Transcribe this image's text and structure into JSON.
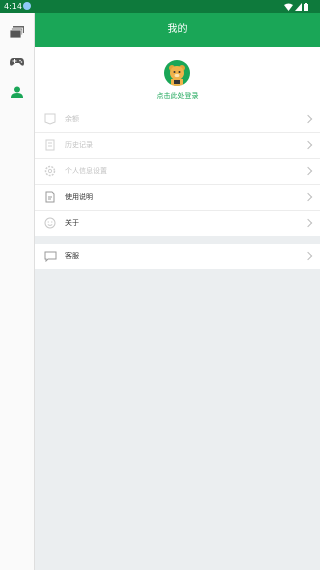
{
  "status_bar": {
    "time": "4:14"
  },
  "sidebar": {
    "items": [
      "books-icon",
      "gamepad-icon",
      "user-icon"
    ],
    "active": "user-icon"
  },
  "header": {
    "title": "我的"
  },
  "profile": {
    "login_text": "点击此处登录"
  },
  "menu": {
    "items": [
      {
        "label": "余额",
        "icon": "wallet-icon",
        "enabled": false
      },
      {
        "label": "历史记录",
        "icon": "history-icon",
        "enabled": false
      },
      {
        "label": "个人信息设置",
        "icon": "settings-icon",
        "enabled": false
      },
      {
        "label": "使用说明",
        "icon": "document-icon",
        "enabled": true
      },
      {
        "label": "关于",
        "icon": "smile-icon",
        "enabled": true
      }
    ]
  },
  "support": {
    "label": "客服",
    "icon": "chat-icon"
  },
  "colors": {
    "brand_green": "#1aa657",
    "statusbar_green": "#0e7a3c",
    "background": "#ebeef0"
  }
}
